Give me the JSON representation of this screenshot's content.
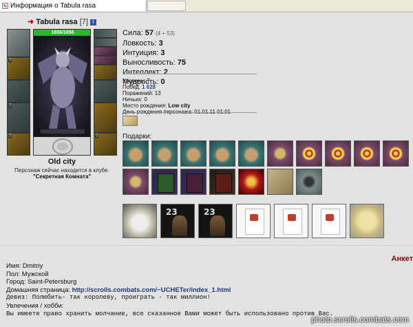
{
  "window": {
    "tab_title": "Информация о Tabula rasa"
  },
  "character": {
    "name": "Tabula rasa",
    "level": "[7]",
    "info_icon": "i",
    "hp": "1656/1656",
    "city": "Old city",
    "club_text": "Персонаж сейчас находится в клубе.",
    "room": "\"Секретная Комната\""
  },
  "stats": [
    {
      "label": "Сила:",
      "value": "57",
      "extra": "(4 + 53)"
    },
    {
      "label": "Ловкость:",
      "value": "3",
      "extra": ""
    },
    {
      "label": "Интуиция:",
      "value": "3",
      "extra": ""
    },
    {
      "label": "Выносливость:",
      "value": "75",
      "extra": ""
    },
    {
      "label": "Интеллект:",
      "value": "2",
      "extra": ""
    },
    {
      "label": "Мудрость:",
      "value": "0",
      "extra": ""
    }
  ],
  "details": {
    "level_label": "Уровень:",
    "level_value": "7",
    "wins_label": "Побед:",
    "wins_value": "1 628",
    "losses_label": "Поражений:",
    "losses_value": "13",
    "draws_label": "Ничьих:",
    "draws_value": "0",
    "birthplace_label": "Место рождения:",
    "birthplace_value": "Low city",
    "birthday_label": "День рождения персонажа:",
    "birthday_value": "01.01.11 01:01"
  },
  "gifts_label": "Подарки:",
  "anketa_label": "Анкет",
  "bio": {
    "name": "Имя: Dmitriy",
    "gender": "Пол: Мужской",
    "city": "Город: Saint-Petersburg",
    "homepage_label": "Домашняя страница: ",
    "homepage_url": "http://scrolls.combats.com/~UCHETer/index_1.html",
    "motto": "Девиз: Полюбить- так королеву, проиграть - так миллион!",
    "hobbies": "Увлечения / хобби:",
    "hobbies_text": "Вы имеете право хранить молчание, все сказанное Вами может быть использовано против Вас."
  },
  "watermark": "photo.scrolls.combats.com",
  "icons": {
    "tab": "flag-icon",
    "arrow": "arrow-right-icon",
    "info": "info-icon"
  },
  "colors": {
    "hp_bar": "#2db52d",
    "anketa": "#8b0000",
    "link": "#1a3a7a"
  }
}
